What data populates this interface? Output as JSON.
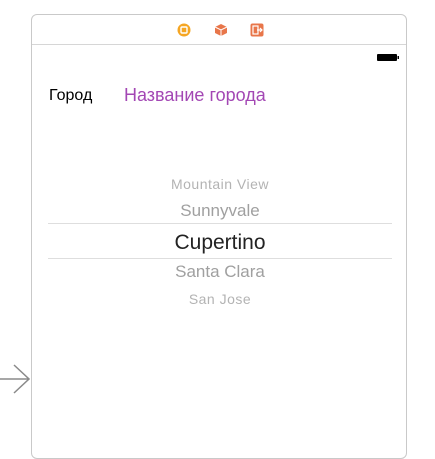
{
  "dock": {
    "icons": [
      "view-controller-icon",
      "first-responder-icon",
      "exit-icon"
    ],
    "colors": {
      "view_controller": "#f5a623",
      "first_responder": "#e8764a",
      "exit": "#e8764a"
    }
  },
  "status_bar": {
    "battery_icon": "battery-icon"
  },
  "form": {
    "city_label": "Город",
    "city_value": "Название города",
    "value_color": "#a347b4"
  },
  "picker": {
    "rows": [
      "Mountain View",
      "Sunnyvale",
      "Cupertino",
      "Santa Clara",
      "San Jose"
    ],
    "selected": "Cupertino"
  },
  "canvas": {
    "entry_arrow_icon": "entry-point-arrow-icon"
  }
}
